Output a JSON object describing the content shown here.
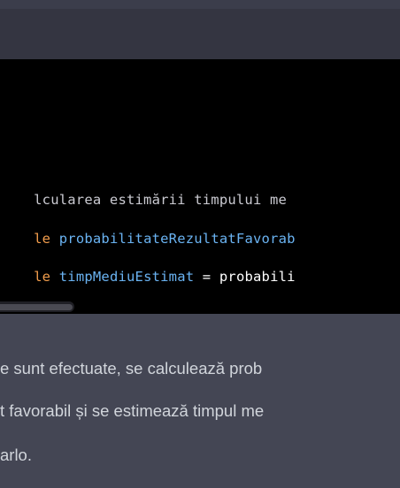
{
  "code": {
    "lines": [
      {
        "comment": "lcularea estimării timpului me"
      },
      {
        "keyword": "le ",
        "identifier": "probabilitateRezultatFavorab"
      },
      {
        "keyword": "le ",
        "identifier": "timpMediuEstimat",
        "operator": " = ",
        "rest": "probabili"
      }
    ]
  },
  "paragraph": {
    "lines": [
      "e sunt efectuate, se calculează prob",
      "t favorabil și se estimează timpul me",
      "arlo."
    ]
  }
}
